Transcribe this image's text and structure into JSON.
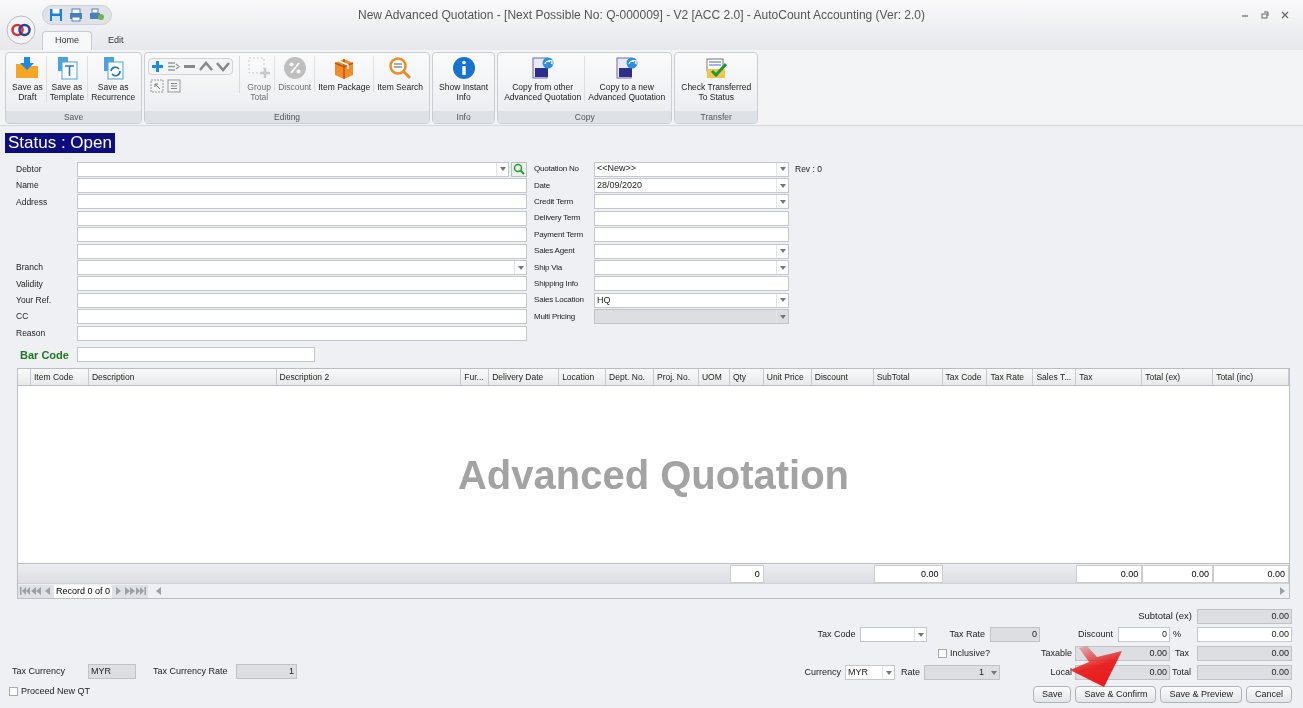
{
  "window": {
    "title": "New Advanced Quotation - [Next Possible No: Q-000009] - V2 [ACC 2.0] - AutoCount Accounting (Ver: 2.0)"
  },
  "tabs": [
    {
      "label": "Home",
      "selected": true
    },
    {
      "label": "Edit",
      "selected": false
    }
  ],
  "ribbon": [
    {
      "name": "Save",
      "items": [
        {
          "kind": "draft",
          "lines": [
            "Save as",
            "Draft"
          ],
          "disabled": false
        },
        {
          "kind": "template",
          "lines": [
            "Save as",
            "Template"
          ],
          "disabled": false
        },
        {
          "kind": "recurrence",
          "lines": [
            "Save as",
            "Recurrence"
          ],
          "disabled": false
        }
      ]
    },
    {
      "name": "Editing",
      "tools": true,
      "items": [
        {
          "kind": "group-total",
          "lines": [
            "Group",
            "Total"
          ],
          "disabled": true
        },
        {
          "kind": "discount",
          "lines": [
            "Discount"
          ],
          "disabled": true
        },
        {
          "kind": "package",
          "lines": [
            "Item Package"
          ],
          "disabled": false
        },
        {
          "kind": "search",
          "lines": [
            "Item Search"
          ],
          "disabled": false
        }
      ]
    },
    {
      "name": "Info",
      "items": [
        {
          "kind": "info",
          "lines": [
            "Show Instant",
            "Info"
          ],
          "disabled": false
        }
      ]
    },
    {
      "name": "Copy",
      "items": [
        {
          "kind": "copy-from",
          "lines": [
            "Copy from other",
            "Advanced Quotation"
          ],
          "disabled": false
        },
        {
          "kind": "copy-to",
          "lines": [
            "Copy to a new",
            "Advanced Quotation"
          ],
          "disabled": false
        }
      ]
    },
    {
      "name": "Transfer",
      "items": [
        {
          "kind": "check",
          "lines": [
            "Check Transferred",
            "To Status"
          ],
          "disabled": false
        }
      ]
    }
  ],
  "status": "Status : Open",
  "left_fields": [
    {
      "label": "Debtor",
      "kind": "lookup"
    },
    {
      "label": "Name",
      "kind": "text"
    },
    {
      "label": "Address",
      "kind": "text"
    },
    {
      "kind": "text"
    },
    {
      "kind": "text"
    },
    {
      "kind": "text"
    },
    {
      "label": "Branch",
      "kind": "dropdown"
    },
    {
      "label": "Validity",
      "kind": "text"
    },
    {
      "label": "Your Ref.",
      "kind": "text"
    },
    {
      "label": "CC",
      "kind": "text"
    },
    {
      "label": "Reason",
      "kind": "text"
    }
  ],
  "right_fields": [
    {
      "label": "Quotation No",
      "kind": "dropdown",
      "value": "<<New>>",
      "disabled": false
    },
    {
      "label": "Date",
      "kind": "dropdown",
      "value": "28/09/2020",
      "disabled": false
    },
    {
      "label": "Credit Term",
      "kind": "dropdown",
      "disabled": false
    },
    {
      "label": "Delivery Term",
      "kind": "text",
      "disabled": false
    },
    {
      "label": "Payment Term",
      "kind": "text",
      "disabled": false
    },
    {
      "label": "Sales Agent",
      "kind": "dropdown",
      "disabled": false
    },
    {
      "label": "Ship Via",
      "kind": "dropdown",
      "disabled": false
    },
    {
      "label": "Shipping Info",
      "kind": "text",
      "disabled": false
    },
    {
      "label": "Sales Location",
      "kind": "dropdown",
      "value": "HQ",
      "disabled": false
    },
    {
      "label": "Multi Pricing",
      "kind": "dropdown",
      "disabled": true
    }
  ],
  "rev": "Rev : 0",
  "bar_code": {
    "label": "Bar Code"
  },
  "grid": {
    "columns": [
      {
        "label": "Item Code"
      },
      {
        "label": "Description"
      },
      {
        "label": "Description 2"
      },
      {
        "label": "Fur..."
      },
      {
        "label": "Delivery Date"
      },
      {
        "label": "Location"
      },
      {
        "label": "Dept. No."
      },
      {
        "label": "Proj. No."
      },
      {
        "label": "UOM"
      },
      {
        "label": "Qty",
        "footer": "0"
      },
      {
        "label": "Unit Price"
      },
      {
        "label": "Discount"
      },
      {
        "label": "SubTotal",
        "footer": "0.00"
      },
      {
        "label": "Tax Code"
      },
      {
        "label": "Tax Rate"
      },
      {
        "label": "Sales T..."
      },
      {
        "label": "Tax",
        "footer": "0.00"
      },
      {
        "label": "Total (ex)",
        "footer": "0.00"
      },
      {
        "label": "Total (inc)",
        "footer": "0.00"
      }
    ],
    "watermark": "Advanced Quotation",
    "navigator": "Record 0 of 0"
  },
  "tax_currency": {
    "label": "Tax Currency",
    "value": "MYR"
  },
  "tax_currency_rate": {
    "label": "Tax Currency Rate",
    "value": "1"
  },
  "proceed_new": {
    "label": "Proceed New QT",
    "checked": false
  },
  "totals": {
    "subtotal": {
      "label": "Subtotal (ex)",
      "value": "0.00"
    },
    "tax_code": {
      "label": "Tax Code"
    },
    "tax_rate": {
      "label": "Tax Rate",
      "value": "0"
    },
    "discount": {
      "label": "Discount",
      "value": "0",
      "unit": "%",
      "amount": "0.00"
    },
    "inclusive": {
      "label": "Inclusive?",
      "checked": false
    },
    "taxable": {
      "label": "Taxable",
      "value": "0.00"
    },
    "tax": {
      "label": "Tax",
      "value": "0.00"
    },
    "currency": {
      "label": "Currency",
      "value": "MYR"
    },
    "rate": {
      "label": "Rate",
      "value": "1"
    },
    "local": {
      "label": "Local",
      "value": "0.00"
    },
    "total": {
      "label": "Total",
      "value": "0.00"
    }
  },
  "buttons": [
    "Save",
    "Save & Confirm",
    "Save & Preview",
    "Cancel"
  ]
}
